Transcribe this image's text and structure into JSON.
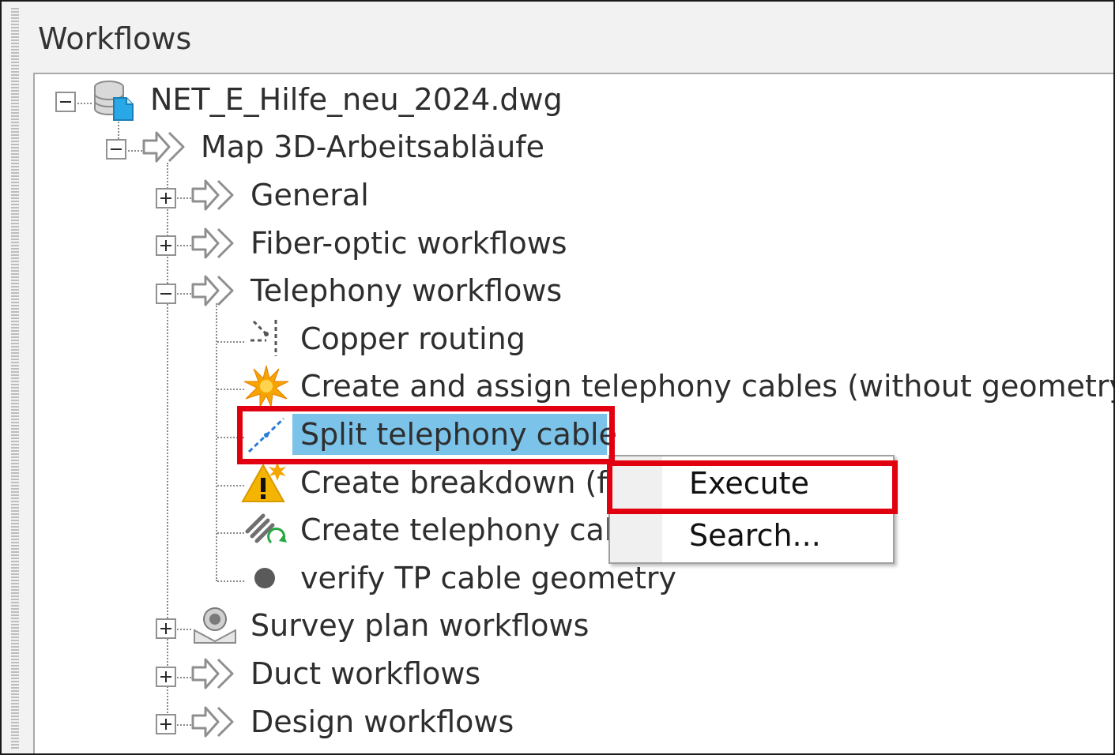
{
  "panel": {
    "title": "Workflows"
  },
  "tree": {
    "root": "NET_E_Hilfe_neu_2024.dwg",
    "map": "Map 3D-Arbeitsabläufe",
    "general": "General",
    "fiber": "Fiber-optic workflows",
    "telephony": "Telephony workflows",
    "copper": "Copper routing",
    "create_assign": "Create and assign telephony cables (without geometry)",
    "split": "Split telephony cable",
    "breakdown": "Create breakdown (fr",
    "create_cab": "Create telephony cab",
    "verify": "verify TP cable geometry",
    "survey": "Survey plan workflows",
    "duct": "Duct workflows",
    "design": "Design workflows"
  },
  "context_menu": {
    "execute": "Execute",
    "search": "Search..."
  },
  "colors": {
    "selection": "#7cc3ea",
    "highlight": "#e10010"
  },
  "icons": {
    "root": "database-document-icon",
    "workflow": "double-arrow-icon",
    "copper": "routing-icon",
    "create_assign": "starburst-icon",
    "split": "split-line-icon",
    "breakdown": "warning-icon",
    "create_cab": "cable-refresh-icon",
    "verify": "dot-icon",
    "survey": "survey-icon"
  }
}
